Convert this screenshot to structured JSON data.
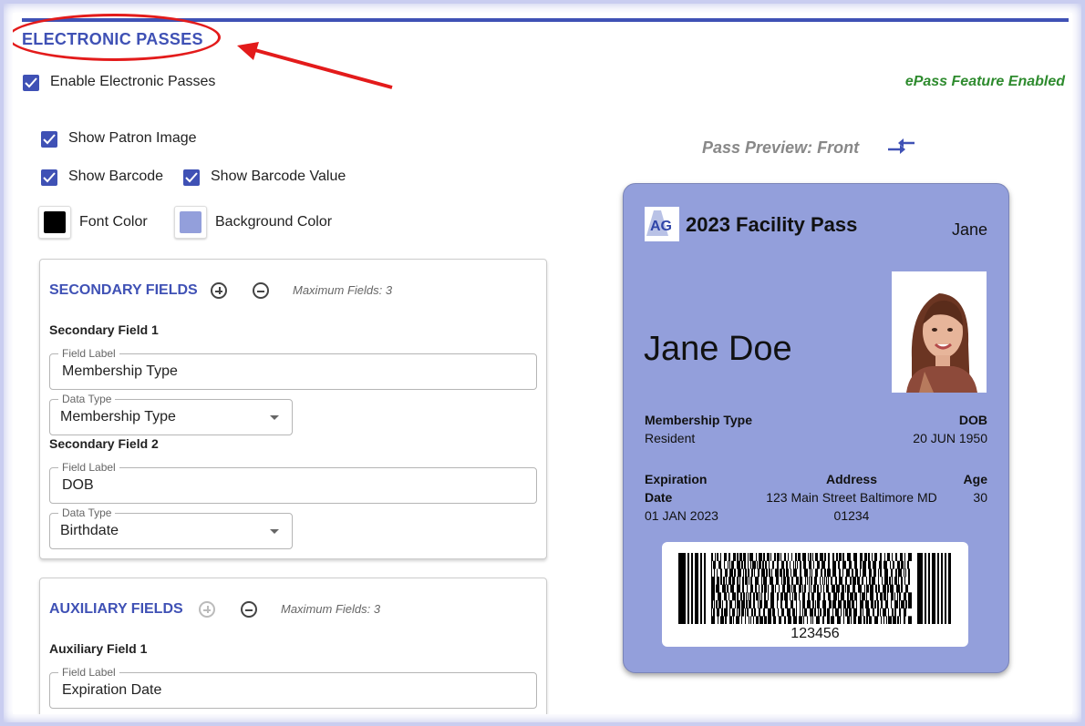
{
  "section": {
    "title": "ELECTRONIC PASSES"
  },
  "enable": {
    "label": "Enable Electronic Passes",
    "status": "ePass Feature Enabled",
    "status_color": "#2e8b2e"
  },
  "options": {
    "show_patron_image": "Show Patron Image",
    "show_barcode": "Show Barcode",
    "show_barcode_value": "Show Barcode Value",
    "font_color_label": "Font Color",
    "font_color": "#000000",
    "background_color_label": "Background Color",
    "background_color": "#939fdb"
  },
  "secondary": {
    "title": "SECONDARY FIELDS",
    "max": "Maximum Fields: 3",
    "fields": [
      {
        "heading": "Secondary Field 1",
        "label_legend": "Field Label",
        "label_value": "Membership Type",
        "type_legend": "Data Type",
        "type_value": "Membership Type"
      },
      {
        "heading": "Secondary Field 2",
        "label_legend": "Field Label",
        "label_value": "DOB",
        "type_legend": "Data Type",
        "type_value": "Birthdate"
      }
    ]
  },
  "auxiliary": {
    "title": "AUXILIARY FIELDS",
    "max": "Maximum Fields: 3",
    "fields": [
      {
        "heading": "Auxiliary Field 1",
        "label_legend": "Field Label",
        "label_value": "Expiration Date"
      }
    ]
  },
  "preview": {
    "title": "Pass Preview: Front",
    "pass": {
      "logo_text": "AG",
      "title": "2023 Facility Pass",
      "header_name": "Jane",
      "primary": "Jane Doe",
      "secondary": [
        {
          "label": "Membership Type",
          "value": "Resident"
        },
        {
          "label": "DOB",
          "value": "20 JUN 1950"
        }
      ],
      "auxiliary": [
        {
          "label_line1": "Expiration",
          "label_line2": "Date",
          "value": "01 JAN 2023"
        },
        {
          "label": "Address",
          "value_line1": "123 Main Street Baltimore MD",
          "value_line2": "01234"
        },
        {
          "label": "Age",
          "value": "30"
        }
      ],
      "barcode_value": "123456"
    }
  },
  "colors": {
    "accent": "#3f51b5",
    "annotation": "#e31b1b"
  }
}
